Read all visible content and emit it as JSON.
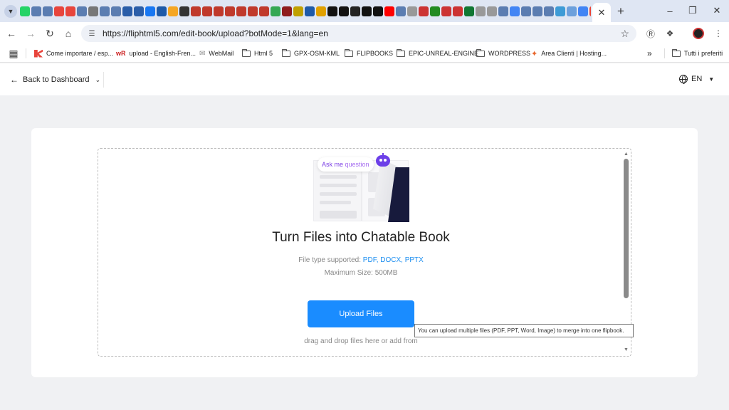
{
  "browser": {
    "favicon_colors": [
      "#25d366",
      "#5b7db1",
      "#5b7db1",
      "#e8453c",
      "#e8453c",
      "#5b7db1",
      "#777777",
      "#5b7db1",
      "#5b7db1",
      "#2a5da8",
      "#2a5da8",
      "#1877f2",
      "#1e5aa8",
      "#f5a623",
      "#333333",
      "#c0392b",
      "#c0392b",
      "#c0392b",
      "#c0392b",
      "#c0392b",
      "#c0392b",
      "#c0392b",
      "#34a853",
      "#8e1c1c",
      "#c0a000",
      "#1e5aa8",
      "#e0a000",
      "#111111",
      "#111111",
      "#222222",
      "#111111",
      "#111111",
      "#ff0000",
      "#5b7db1",
      "#999999",
      "#cc3333",
      "#228b22",
      "#cc3333",
      "#cc3333",
      "#117733",
      "#999999",
      "#999999",
      "#5b7db1",
      "#4285f4",
      "#5b7db1",
      "#5b7db1",
      "#5b7db1",
      "#3d9bd6",
      "#6ca0dc",
      "#4285f4",
      "#ea4335",
      "#4b7bec",
      "#1e90ff",
      "#e53935",
      "#2f80ed"
    ],
    "address": {
      "url": "https://fliphtml5.com/edit-book/upload?botMode=1&lang=en"
    },
    "bookmarks": [
      {
        "label": "Come importare / esp...",
        "icon": "red-k-icon"
      },
      {
        "label": "upload - English-Fren...",
        "icon": "wr-icon"
      },
      {
        "label": "WebMail",
        "icon": "webmail-icon"
      },
      {
        "label": "Html 5",
        "icon": "folder-icon"
      },
      {
        "label": "GPX-OSM-KML",
        "icon": "folder-icon"
      },
      {
        "label": "FLIPBOOKS",
        "icon": "folder-icon"
      },
      {
        "label": "EPIC-UNREAL-ENGINE",
        "icon": "folder-icon"
      },
      {
        "label": "WORDPRESS",
        "icon": "folder-icon"
      },
      {
        "label": "Area Clienti | Hosting...",
        "icon": "sparkle-icon"
      }
    ],
    "all_bookmarks_label": "Tutti i preferiti"
  },
  "header": {
    "back_label": "Back to Dashboard",
    "language": "EN"
  },
  "upload": {
    "bubble_prefix": "Ask me",
    "bubble_suffix": " question",
    "title": "Turn Files into Chatable Book",
    "supported_prefix": "File type supported: ",
    "supported_types": "PDF, DOCX, PPTX",
    "max_size": "Maximum Size: 500MB",
    "button_label": "Upload Files",
    "drag_drop_text": "drag and drop files here or add from",
    "tooltip": "You can upload multiple files (PDF, PPT, Word, Image) to merge into one flipbook."
  },
  "colors": {
    "accent": "#1a8cff",
    "link": "#1a8df0",
    "robot": "#6c3fe8"
  }
}
